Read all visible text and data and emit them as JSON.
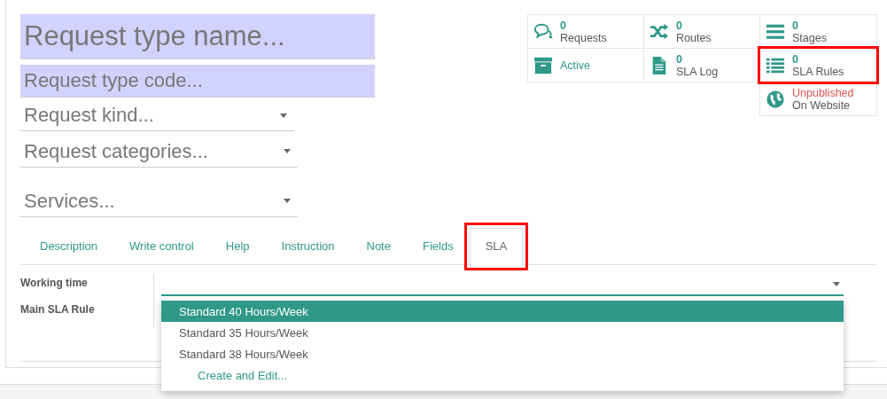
{
  "header_fields": [
    {
      "placeholder": "Request type name...",
      "kind": "title",
      "dropdown": false
    },
    {
      "placeholder": "Request type code...",
      "kind": "code",
      "dropdown": false
    },
    {
      "placeholder": "Request kind...",
      "kind": "many2one",
      "dropdown": true
    },
    {
      "placeholder": "Request categories...",
      "kind": "many2one",
      "dropdown": true
    },
    {
      "placeholder": "Services...",
      "kind": "spaced",
      "dropdown": true
    }
  ],
  "button_box": [
    {
      "kind": "stat",
      "count": "0",
      "label": "Requests",
      "highlighted": false
    },
    {
      "kind": "stat",
      "count": "0",
      "label": "Routes",
      "highlighted": false
    },
    {
      "kind": "stat",
      "count": "0",
      "label": "Stages",
      "highlighted": false
    },
    {
      "kind": "toggle",
      "label": "Active",
      "highlighted": false
    },
    {
      "kind": "stat",
      "count": "0",
      "label": "SLA Log",
      "highlighted": false
    },
    {
      "kind": "stat",
      "count": "0",
      "label": "SLA Rules",
      "highlighted": true
    },
    {
      "kind": "website",
      "status": "Unpublished",
      "label": "On Website",
      "highlighted": false
    }
  ],
  "tabs": [
    {
      "label": "Description",
      "selected": false,
      "highlighted": false
    },
    {
      "label": "Write control",
      "selected": false,
      "highlighted": false
    },
    {
      "label": "Help",
      "selected": false,
      "highlighted": false
    },
    {
      "label": "Instruction",
      "selected": false,
      "highlighted": false
    },
    {
      "label": "Note",
      "selected": false,
      "highlighted": false
    },
    {
      "label": "Fields",
      "selected": false,
      "highlighted": false
    },
    {
      "label": "SLA",
      "selected": true,
      "highlighted": true
    }
  ],
  "form": {
    "labels": [
      "Working time",
      "Main SLA Rule"
    ]
  },
  "dropdown": {
    "options": [
      {
        "kind": "option",
        "label": "Standard 40 Hours/Week",
        "selected": true
      },
      {
        "kind": "option",
        "label": "Standard 35 Hours/Week",
        "selected": false
      },
      {
        "kind": "option",
        "label": "Standard 38 Hours/Week",
        "selected": false
      },
      {
        "kind": "action",
        "label": "Create and Edit...",
        "selected": false
      }
    ]
  }
}
